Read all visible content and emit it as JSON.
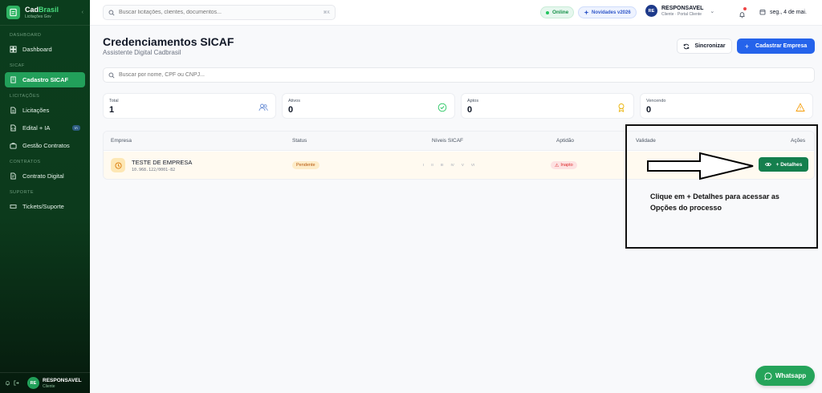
{
  "brand": {
    "name_prefix": "Cad",
    "name_accent": "Brasil",
    "subtitle": "Licitações Gov"
  },
  "sidebar": {
    "sections": [
      {
        "label": "DASHBOARD",
        "items": [
          {
            "label": "Dashboard",
            "icon": "dashboard-icon"
          }
        ]
      },
      {
        "label": "SICAF",
        "items": [
          {
            "label": "Cadastro SICAF",
            "icon": "building-icon",
            "active": true
          }
        ]
      },
      {
        "label": "LICITAÇÕES",
        "items": [
          {
            "label": "Licitações",
            "icon": "document-icon"
          },
          {
            "label": "Edital + IA",
            "icon": "file-code-icon",
            "badge": "IA"
          },
          {
            "label": "Gestão Contratos",
            "icon": "briefcase-icon"
          }
        ]
      },
      {
        "label": "CONTRATOS",
        "items": [
          {
            "label": "Contrato Digital",
            "icon": "contract-icon"
          }
        ]
      },
      {
        "label": "SUPORTE",
        "items": [
          {
            "label": "Tickets/Suporte",
            "icon": "ticket-icon"
          }
        ]
      }
    ],
    "footer": {
      "avatar": "RE",
      "name": "RESPONSAVEL",
      "role": "Cliente"
    }
  },
  "header": {
    "search_placeholder": "Buscar licitações, clientes, documentos...",
    "search_shortcut": "⌘K",
    "online_label": "Online",
    "novidades_label": "Novidades v2026",
    "user": {
      "avatar": "RE",
      "name": "RESPONSAVEL",
      "role": "Cliente · Portal Cliente"
    },
    "date": "seg., 4 de mai."
  },
  "page": {
    "title": "Credenciamentos SICAF",
    "subtitle": "Assistente Digital Cadbrasil",
    "sync_label": "Sincronizar",
    "create_label": "Cadastrar Empresa",
    "search_placeholder": "Buscar por nome, CPF ou CNPJ..."
  },
  "stats": [
    {
      "label": "Total",
      "value": "1",
      "icon": "users-icon",
      "color": "#6b8fd6"
    },
    {
      "label": "Ativos",
      "value": "0",
      "icon": "check-circle-icon",
      "color": "#22c55e"
    },
    {
      "label": "Aptos",
      "value": "0",
      "icon": "award-icon",
      "color": "#eab308"
    },
    {
      "label": "Vencendo",
      "value": "0",
      "icon": "warning-icon",
      "color": "#f59e0b"
    }
  ],
  "table": {
    "columns": [
      "Empresa",
      "Status",
      "Níveis SICAF",
      "Aptidão",
      "Validade",
      "Ações"
    ],
    "rows": [
      {
        "empresa": "TESTE DE EMPRESA",
        "cnpj": "10.968.122/0001-82",
        "status": "Pendente",
        "niveis": [
          "I",
          "II",
          "III",
          "IV",
          "V",
          "VI"
        ],
        "aptidao": "Inapto",
        "action": "+ Detalhes"
      }
    ]
  },
  "annotation": {
    "text": "Clique em + Detalhes para acessar as Opções do processo"
  },
  "whatsapp_label": "Whatsapp",
  "colors": {
    "sidebar": "#0b3d1d",
    "active": "#22a05a",
    "primary": "#2563eb",
    "detalhes": "#157f4d",
    "whatsapp": "#25a45a"
  }
}
